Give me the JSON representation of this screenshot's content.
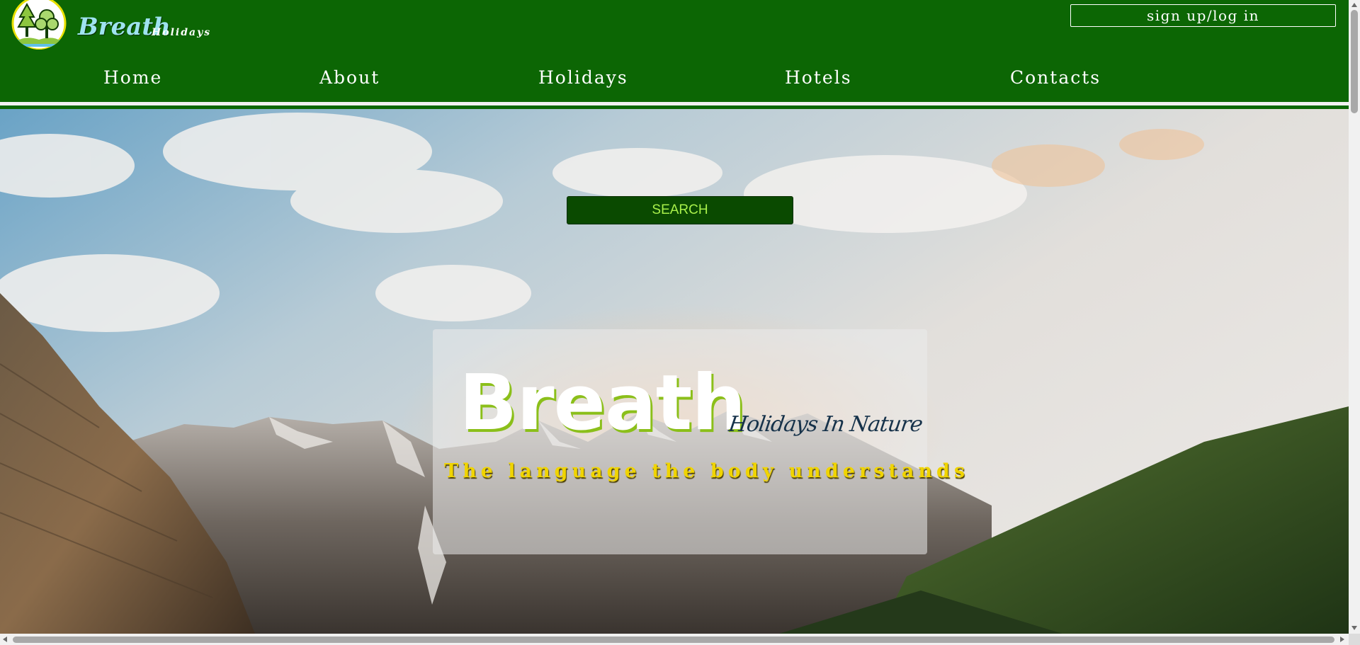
{
  "header": {
    "brand_name": "Breath",
    "brand_sub": "Holidays",
    "signup_label": "sign up/log in",
    "logo_icon": "trees-logo-icon"
  },
  "nav": {
    "items": [
      {
        "label": "Home"
      },
      {
        "label": "About"
      },
      {
        "label": "Holidays"
      },
      {
        "label": "Hotels"
      },
      {
        "label": "Contacts"
      }
    ]
  },
  "hero": {
    "search_label": "SEARCH",
    "title": "Breath",
    "subtitle": "Holidays In Nature",
    "tagline": "The language the body understands"
  },
  "colors": {
    "header_bg": "#0c6604",
    "search_bg": "#0a4a00",
    "search_text": "#a8f04a",
    "tagline_text": "#f0d400",
    "title_shadow": "#8bbf1a"
  }
}
